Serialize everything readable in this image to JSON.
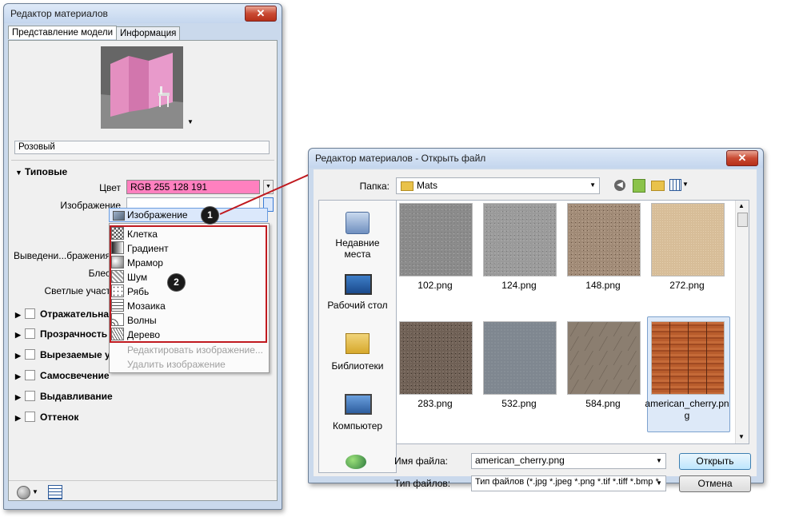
{
  "material_editor": {
    "title": "Редактор материалов",
    "close_label": "✕",
    "tabs": [
      "Представление модели",
      "Информация"
    ],
    "material_name": "Розовый",
    "generic_section": "Типовые",
    "color_label": "Цвет",
    "color_value": "RGB 255 128 191",
    "color_swatch": "#ff80bf",
    "image_label": "Изображение",
    "image_value": "",
    "hidden_labels": [
      "Выведени...бражения",
      "Блес",
      "Светлые участ"
    ],
    "sections": [
      "Отражательная с",
      "Прозрачность",
      "Вырезаемые у",
      "Самосвечение",
      "Выдавливание",
      "Оттенок"
    ],
    "menu": {
      "selected": "Изображение",
      "items": [
        "Клетка",
        "Градиент",
        "Мрамор",
        "Шум",
        "Рябь",
        "Мозаика",
        "Волны",
        "Дерево"
      ],
      "disabled": [
        "Редактировать изображение...",
        "Удалить изображение"
      ]
    },
    "badges": [
      "1",
      "2"
    ],
    "accent": "#c0191f"
  },
  "open_dialog": {
    "title": "Редактор материалов - Открыть файл",
    "close_label": "✕",
    "folder_label": "Папка:",
    "folder_value": "Mats",
    "places": [
      "Недавние места",
      "Рабочий стол",
      "Библиотеки",
      "Компьютер",
      ""
    ],
    "files": [
      {
        "name": "102.png",
        "color": "#8c8c8c"
      },
      {
        "name": "124.png",
        "color": "#9a9a9a"
      },
      {
        "name": "148.png",
        "color": "#a08a76"
      },
      {
        "name": "272.png",
        "color": "#d7bd98"
      },
      {
        "name": "283.png",
        "color": "#6f6055"
      },
      {
        "name": "532.png",
        "color": "#7f8790"
      },
      {
        "name": "584.png",
        "color": "#8b7e70"
      },
      {
        "name": "american_cherry.png",
        "color": "#b1552a"
      }
    ],
    "filename_label": "Имя файла:",
    "filename_value": "american_cherry.png",
    "filetype_label": "Тип файлов:",
    "filetype_value": "Тип файлов (*.jpg *.jpeg *.png *.tif *.tiff *.bmp *",
    "open_button": "Открыть",
    "cancel_button": "Отмена"
  }
}
